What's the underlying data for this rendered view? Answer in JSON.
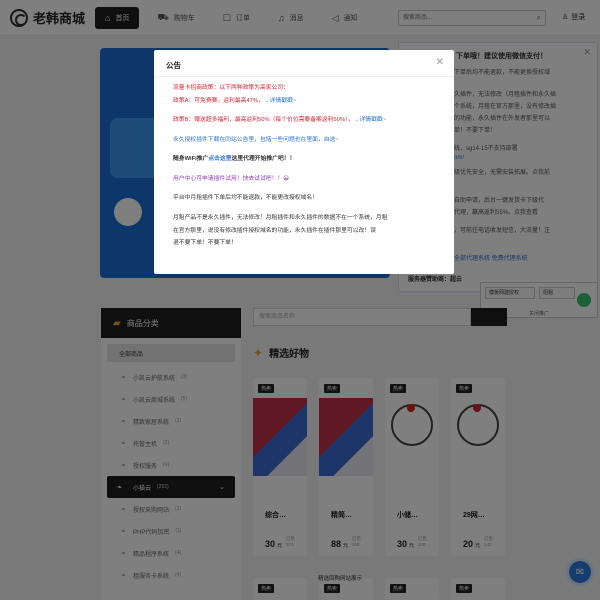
{
  "header": {
    "logo_text": "老韩商城",
    "nav": [
      {
        "label": "首页",
        "icon": "home-icon",
        "glyph": "⌂",
        "active": true
      },
      {
        "label": "购物车",
        "icon": "cart-icon",
        "glyph": "⛟",
        "active": false
      },
      {
        "label": "订单",
        "icon": "order-icon",
        "glyph": "☐",
        "active": false
      },
      {
        "label": "消息",
        "icon": "bell-icon",
        "glyph": "♫",
        "active": false
      },
      {
        "label": "通知",
        "icon": "megaphone-icon",
        "glyph": "◁",
        "active": false
      }
    ],
    "search_placeholder": "搜索商品...",
    "login_label": "登录"
  },
  "notice_panel": {
    "title": "下单哦！建议使用微信支付！",
    "lines": [
      "下单后均不能退款，不能更换授权域",
      "久插件，无法修改（月租插件和永久插",
      "个系统，月租在官方那里，没有修改插",
      "的功能，永久插件在外发者那里可以",
      "单！不要下单！",
      "统，sg14-15不支持部署",
      "om/",
      "级优先安全，无需安装拓展。点我前",
      "自助申请，后台一键发货卡下级代",
      "代理，赢高返利55%。点我查看",
      "，可前往电话收发短信，大流量！注"
    ],
    "link_line": "全部代理系统 免费代理系统",
    "footer": "服务器赞助商：超云"
  },
  "qa_widget": {
    "input1": "模板网建授权",
    "input2": "招租",
    "footer": "关闭推广"
  },
  "sidebar": {
    "title": "商品分类",
    "all_label": "全部商品",
    "items": [
      {
        "label": "小凯云护航系统",
        "count": "(3)"
      },
      {
        "label": "小凯云商城系统",
        "count": "(5)"
      },
      {
        "label": "精致家居系统",
        "count": "(2)"
      },
      {
        "label": "托管主机",
        "count": "(2)"
      },
      {
        "label": "授权服务",
        "count": "(4)"
      },
      {
        "label": "小猫云",
        "count": "(252)",
        "active": true
      },
      {
        "label": "授权采购网站",
        "count": "(2)"
      },
      {
        "label": "PHP代码加密",
        "count": "(1)"
      },
      {
        "label": "精品程序系统",
        "count": "(4)"
      },
      {
        "label": "租服务卡系统",
        "count": "(4)"
      }
    ]
  },
  "goods": {
    "search_placeholder": "搜索商品名称",
    "featured_title": "精选好物",
    "badge": "热卖",
    "yuan": "元",
    "sold_label": "已售",
    "cards": [
      {
        "name": "综合…",
        "price": "30",
        "sold": "573",
        "img": "red"
      },
      {
        "name": "精简…",
        "price": "88",
        "sold": "158",
        "img": "red"
      },
      {
        "name": "小储…",
        "price": "30",
        "sold": "108",
        "img": "hz"
      },
      {
        "name": "29网…",
        "price": "20",
        "sold": "142",
        "img": "hz"
      }
    ],
    "img_alt": "精选回购网站展示"
  },
  "modal": {
    "title": "公告",
    "line1": "流量卡招商政策：以下两种政策为高家公司：",
    "line2a": "政策A：可免费赛，返利最高47%，",
    "line2b": "→详情戳戳~",
    "line3a": "政策B：赠送超多福利，最高返利50%（每个价位需要备案返利50%），",
    "line3b": "→详情戳戳~",
    "line4": "永久授权插件下载在同站公告里，包括一些问题也在里面，自选~",
    "line5a": "随身WiFi推广",
    "line5b": "点击这里",
    "line5c": "这里代理开始推广吧！！",
    "line6": "用户中心可申请插件试用！快去试试吧！！😀",
    "line7": "平台中月租插件下单后均不能退款，不能更改授权域名！",
    "line8a": "月租产品不是永久插件，无法修改！月租插件和永久插件的数据不在一个系统，月租",
    "line8b": "在官方那里，说没有修改插件授权域名的功能，永久插件在插件那里可以改！误",
    "line8c": "退不要下单！不要下单！"
  },
  "colors": {
    "accent_dark": "#1f1f1f",
    "red_text": "#d3242f",
    "blue_text": "#2d6fd3",
    "purple_text": "#8a3fb8",
    "chat_button": "#2d7be0"
  }
}
